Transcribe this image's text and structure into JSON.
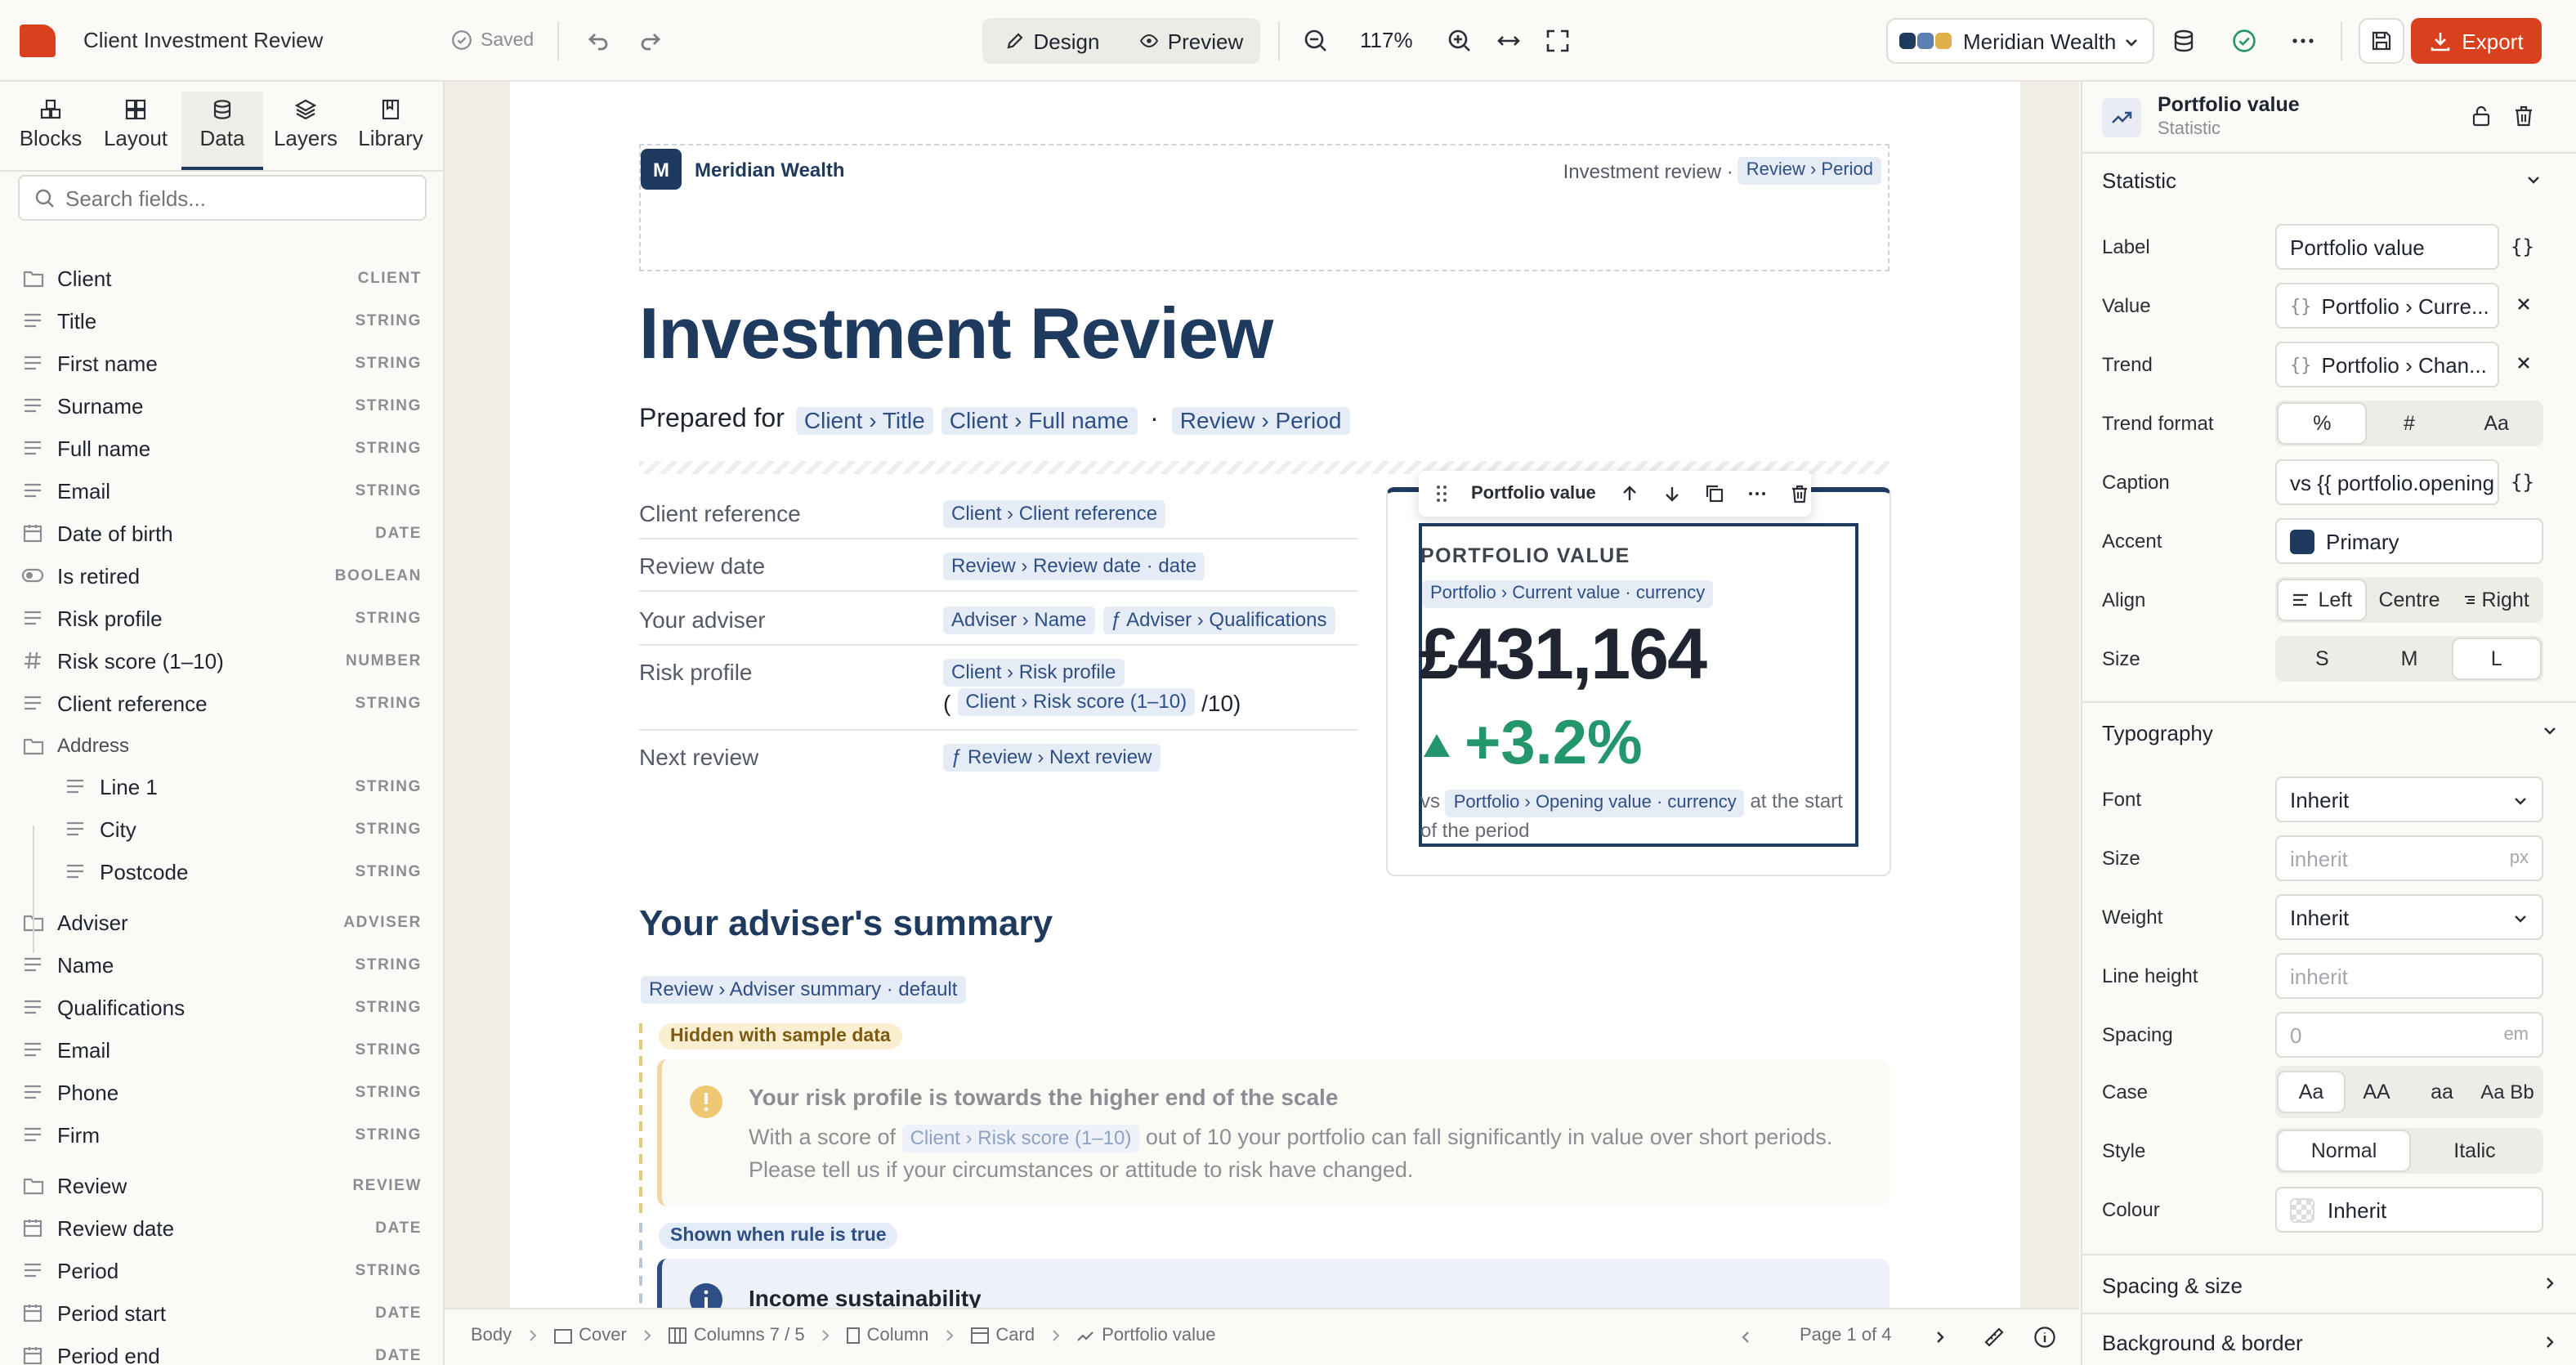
{
  "topbar": {
    "doc_title": "Client Investment Review",
    "saved": "Saved",
    "design": "Design",
    "preview": "Preview",
    "zoom": "117%",
    "brand": "Meridian Wealth",
    "export": "Export",
    "brand_colors": [
      "#1e3a5f",
      "#5b7fb0",
      "#e0b04a"
    ],
    "accent": "#d9401d"
  },
  "left": {
    "tabs": [
      "Blocks",
      "Layout",
      "Data",
      "Layers",
      "Library"
    ],
    "active_tab": "Data",
    "search_placeholder": "Search fields...",
    "fields": [
      {
        "label": "Client",
        "type": "CLIENT",
        "icon": "folder-icon"
      },
      {
        "label": "Title",
        "type": "STRING",
        "icon": "text-icon"
      },
      {
        "label": "First name",
        "type": "STRING",
        "icon": "text-icon"
      },
      {
        "label": "Surname",
        "type": "STRING",
        "icon": "text-icon"
      },
      {
        "label": "Full name",
        "type": "STRING",
        "icon": "text-icon"
      },
      {
        "label": "Email",
        "type": "STRING",
        "icon": "text-icon"
      },
      {
        "label": "Date of birth",
        "type": "DATE",
        "icon": "calendar-icon"
      },
      {
        "label": "Is retired",
        "type": "BOOLEAN",
        "icon": "toggle-icon"
      },
      {
        "label": "Risk profile",
        "type": "STRING",
        "icon": "text-icon"
      },
      {
        "label": "Risk score (1–10)",
        "type": "NUMBER",
        "icon": "hash-icon"
      },
      {
        "label": "Client reference",
        "type": "STRING",
        "icon": "text-icon"
      },
      {
        "label": "Address",
        "type": "",
        "icon": "folder-icon"
      },
      {
        "label": "Line 1",
        "type": "STRING",
        "icon": "text-icon"
      },
      {
        "label": "City",
        "type": "STRING",
        "icon": "text-icon"
      },
      {
        "label": "Postcode",
        "type": "STRING",
        "icon": "text-icon"
      },
      {
        "label": "Adviser",
        "type": "ADVISER",
        "icon": "folder-icon"
      },
      {
        "label": "Name",
        "type": "STRING",
        "icon": "text-icon"
      },
      {
        "label": "Qualifications",
        "type": "STRING",
        "icon": "text-icon"
      },
      {
        "label": "Email",
        "type": "STRING",
        "icon": "text-icon"
      },
      {
        "label": "Phone",
        "type": "STRING",
        "icon": "text-icon"
      },
      {
        "label": "Firm",
        "type": "STRING",
        "icon": "text-icon"
      },
      {
        "label": "Review",
        "type": "REVIEW",
        "icon": "folder-icon"
      },
      {
        "label": "Review date",
        "type": "DATE",
        "icon": "calendar-icon"
      },
      {
        "label": "Period",
        "type": "STRING",
        "icon": "text-icon"
      },
      {
        "label": "Period start",
        "type": "DATE",
        "icon": "calendar-icon"
      },
      {
        "label": "Period end",
        "type": "DATE",
        "icon": "calendar-icon"
      }
    ]
  },
  "doc": {
    "logo_letter": "M",
    "brand": "Meridian Wealth",
    "header_right": "Investment review ·",
    "header_chip": "Review › Period",
    "title": "Investment Review",
    "prepared_for": "Prepared for",
    "prepared_chips": [
      "Client › Title",
      "Client › Full name",
      "Review › Period"
    ],
    "dot": "·",
    "rows": [
      {
        "label": "Client reference",
        "chip": "Client › Client reference"
      },
      {
        "label": "Review date",
        "chip": "Review › Review date · date"
      },
      {
        "label": "Your adviser",
        "chip": "Adviser › Name",
        "chip2": "ƒ Adviser › Qualifications"
      },
      {
        "label": "Risk profile",
        "chip": "Client › Risk profile",
        "chip2": "Client › Risk score (1–10)",
        "open": "(",
        "close": "/10)"
      },
      {
        "label": "Next review",
        "chip": "ƒ Review › Next review"
      }
    ],
    "card_toolbar_label": "Portfolio value",
    "stat_label": "PORTFOLIO VALUE",
    "stat_chip": "Portfolio › Current value · currency",
    "stat_value": "£431,164",
    "stat_trend": "+3.2%",
    "caption_pre": "vs",
    "caption_chip": "Portfolio › Opening value · currency",
    "caption_post": "at the start of the period",
    "summary_heading": "Your adviser's summary",
    "summary_chip": "Review › Adviser summary · default",
    "hidden_badge": "Hidden with sample data",
    "risk_title": "Your risk profile is towards the higher end of the scale",
    "risk_pre": "With a score of",
    "risk_chip": "Client › Risk score (1–10)",
    "risk_post": "out of 10 your portfolio can fall significantly in value over short periods. Please tell us if your circumstances or attitude to risk have changed.",
    "shown_badge": "Shown when rule is true",
    "income_title": "Income sustainability"
  },
  "status": {
    "crumbs": [
      "Body",
      "Cover",
      "Columns 7 / 5",
      "Column",
      "Card",
      "Portfolio value"
    ],
    "page": "Page 1 of 4"
  },
  "right": {
    "title": "Portfolio value",
    "subtitle": "Statistic",
    "statistic_section": "Statistic",
    "label_label": "Label",
    "label_value": "Portfolio value",
    "value_label": "Value",
    "value_value": "Portfolio › Curre...",
    "trend_label": "Trend",
    "trend_value": "Portfolio › Chan...",
    "trend_format_label": "Trend format",
    "trend_format_options": [
      "%",
      "#",
      "Aa"
    ],
    "caption_label": "Caption",
    "caption_value": "vs {{ portfolio.opening",
    "accent_label": "Accent",
    "accent_value": "Primary",
    "align_label": "Align",
    "align_options": [
      "Left",
      "Centre",
      "Right"
    ],
    "size_label": "Size",
    "size_options": [
      "S",
      "M",
      "L"
    ],
    "typography_section": "Typography",
    "font_label": "Font",
    "font_value": "Inherit",
    "tsize_label": "Size",
    "tsize_placeholder": "inherit",
    "tsize_unit": "px",
    "weight_label": "Weight",
    "weight_value": "Inherit",
    "lh_label": "Line height",
    "lh_placeholder": "inherit",
    "spacing_label": "Spacing",
    "spacing_placeholder": "0",
    "spacing_unit": "em",
    "case_label": "Case",
    "case_options": [
      "Aa",
      "AA",
      "aa",
      "Aa Bb"
    ],
    "style_label": "Style",
    "style_options": [
      "Normal",
      "Italic"
    ],
    "colour_label": "Colour",
    "colour_value": "Inherit",
    "spacing_section": "Spacing & size",
    "bg_section": "Background & border"
  }
}
